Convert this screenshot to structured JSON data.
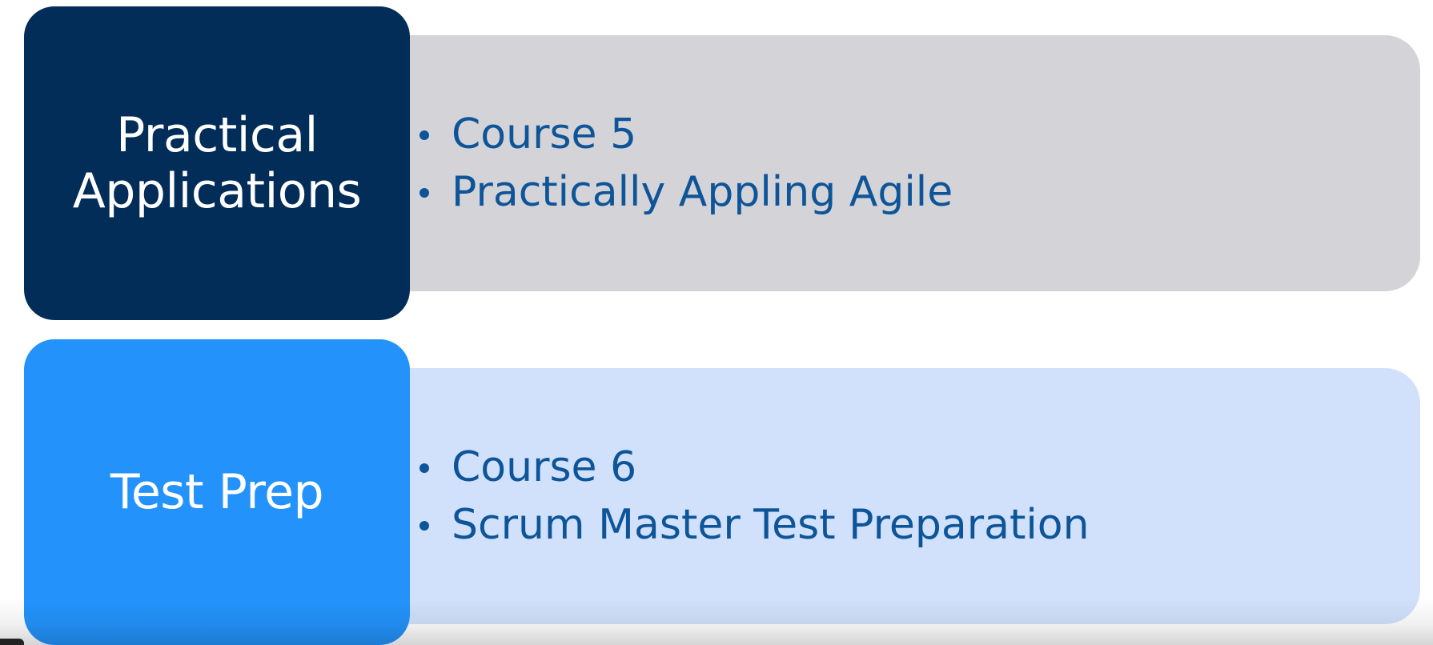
{
  "colors": {
    "dark_navy": "#032d59",
    "bright_blue": "#2393fb",
    "gray_panel": "#d4d3d8",
    "light_blue_panel": "#d1e1fb",
    "bullet_text": "#0d5598"
  },
  "rows": [
    {
      "label_lines": [
        "Practical",
        "Applications"
      ],
      "bullets": [
        "Course 5",
        "Practically Appling Agile"
      ]
    },
    {
      "label_lines": [
        "Test Prep"
      ],
      "bullets": [
        "Course 6",
        "Scrum Master Test Preparation"
      ]
    }
  ]
}
